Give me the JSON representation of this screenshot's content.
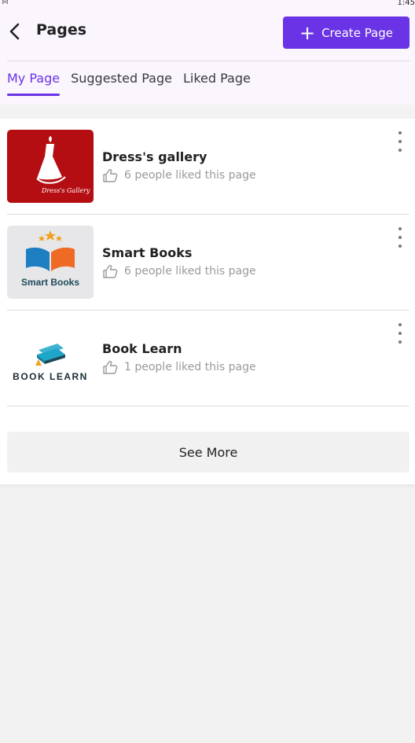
{
  "status": {
    "time": "1:45",
    "icon": "notification-muted-icon"
  },
  "header": {
    "title": "Pages",
    "create_label": "Create Page",
    "accent": "#6a33e6",
    "background": "#fbf5fd"
  },
  "tabs": [
    {
      "label": "My Page",
      "active": true
    },
    {
      "label": "Suggested Page",
      "active": false
    },
    {
      "label": "Liked Page",
      "active": false
    }
  ],
  "pages": [
    {
      "name": "Dress's gallery",
      "likes_text": "6 people liked this page",
      "logo_text": "Dress's Gallery",
      "logo_bg": "#b50e12"
    },
    {
      "name": "Smart Books",
      "likes_text": "6 people liked this page",
      "logo_text": "Smart Books",
      "logo_bg": "#e7e7e9"
    },
    {
      "name": "Book Learn",
      "likes_text": "1 people liked this page",
      "logo_text": "BOOK LEARN",
      "logo_bg": "#ffffff"
    }
  ],
  "see_more_label": "See More"
}
